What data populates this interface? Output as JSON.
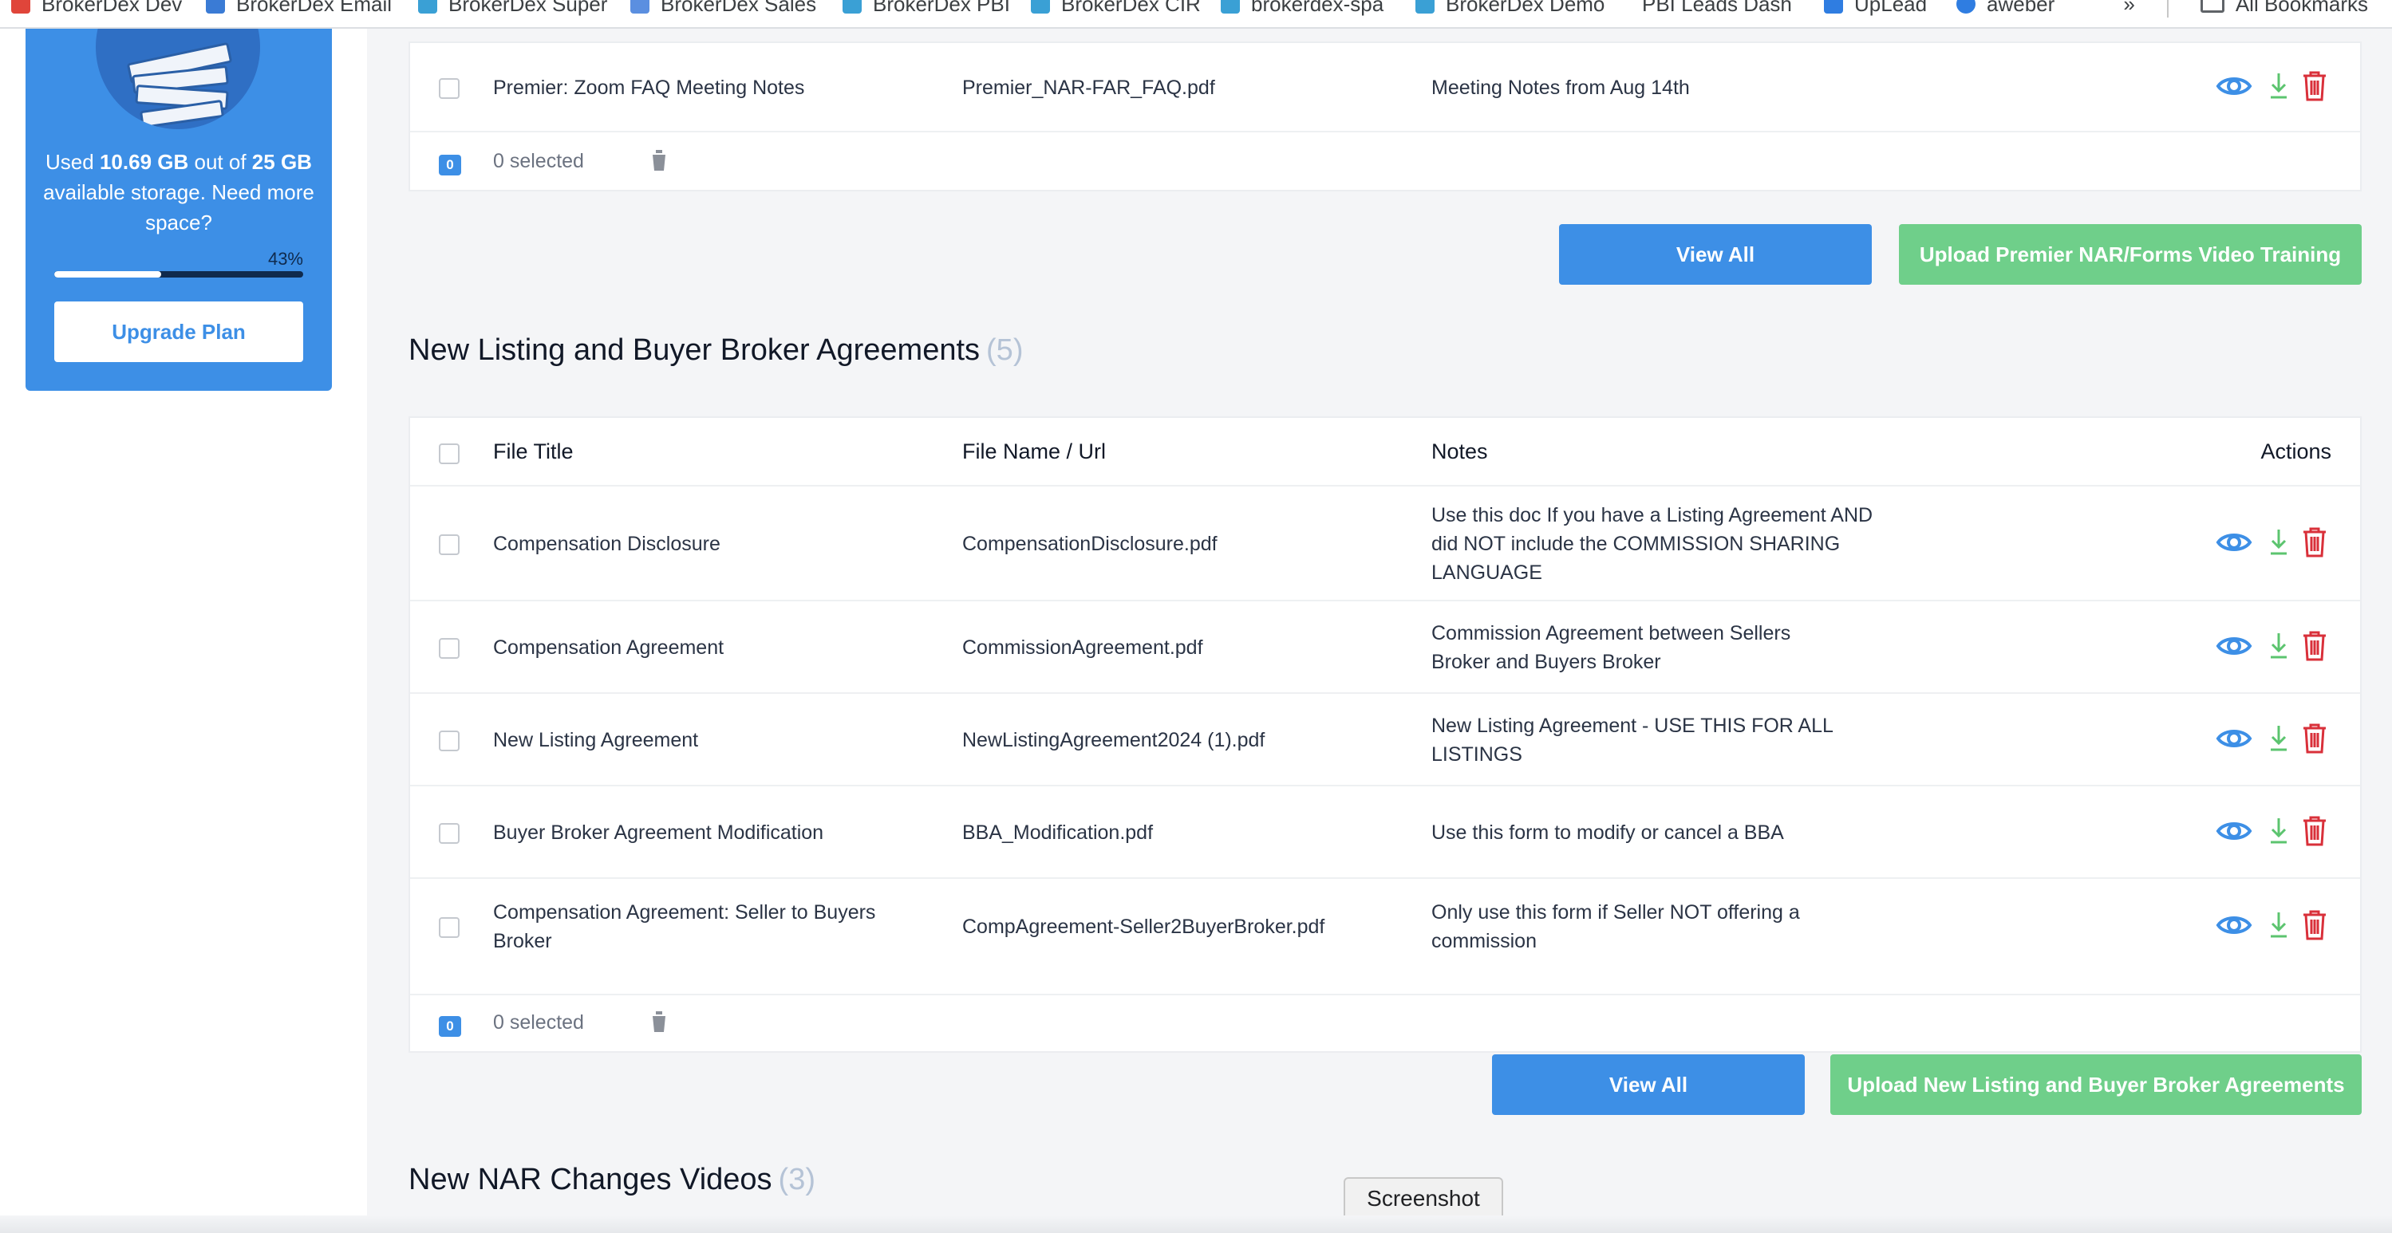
{
  "bookmarks": {
    "items": [
      {
        "label": "BrokerDex Dev",
        "color": "#e0453a"
      },
      {
        "label": "BrokerDex Email",
        "color": "#3a7bd5"
      },
      {
        "label": "BrokerDex Super",
        "color": "#3aa0d5"
      },
      {
        "label": "BrokerDex Sales",
        "color": "#5b8fe0"
      },
      {
        "label": "BrokerDex PBI",
        "color": "#3aa0d5"
      },
      {
        "label": "BrokerDex CIR",
        "color": "#3aa0d5"
      },
      {
        "label": "brokerdex-spa",
        "color": "#3aa0d5"
      },
      {
        "label": "BrokerDex Demo",
        "color": "#3aa0d5"
      },
      {
        "label": "PBI Leads Dash",
        "color": "#ffffff"
      },
      {
        "label": "UpLead",
        "color": "#2f7de1"
      },
      {
        "label": "aweber",
        "color": "#2f7de1"
      }
    ],
    "more": "»",
    "all_bookmarks": "All Bookmarks"
  },
  "storage": {
    "used_prefix": "Used",
    "used_amount": "10.69 GB",
    "out_of": "out of",
    "total": "25 GB",
    "available": "available storage.",
    "need_more": "Need more space?",
    "percent_label": "43%",
    "percent": 0.43,
    "upgrade_label": "Upgrade Plan"
  },
  "premier": {
    "row": {
      "title": "Premier: Zoom FAQ Meeting Notes",
      "file": "Premier_NAR-FAR_FAQ.pdf",
      "notes": "Meeting Notes from Aug 14th"
    },
    "selected_count": "0",
    "selected_text": "0 selected",
    "view_all_label": "View All",
    "upload_label": "Upload Premier NAR/Forms Video Training"
  },
  "agreements": {
    "title": "New Listing and Buyer Broker Agreements",
    "count": "(5)",
    "headers": {
      "title": "File Title",
      "file": "File Name / Url",
      "notes": "Notes",
      "actions": "Actions"
    },
    "rows": [
      {
        "title": "Compensation Disclosure",
        "file": "CompensationDisclosure.pdf",
        "notes": "Use this doc If you have a Listing Agreement AND did NOT include the COMMISSION SHARING LANGUAGE"
      },
      {
        "title": "Compensation Agreement",
        "file": "CommissionAgreement.pdf",
        "notes": "Commission Agreement between Sellers Broker and Buyers Broker"
      },
      {
        "title": "New Listing Agreement",
        "file": "NewListingAgreement2024 (1).pdf",
        "notes": "New Listing Agreement - USE THIS FOR ALL LISTINGS"
      },
      {
        "title": "Buyer Broker Agreement Modification",
        "file": "BBA_Modification.pdf",
        "notes": "Use this form to modify or cancel a BBA"
      },
      {
        "title": "Compensation Agreement: Seller to Buyers Broker",
        "file": "CompAgreement-Seller2BuyerBroker.pdf",
        "notes": "Only use this form if Seller NOT offering a commission"
      }
    ],
    "selected_count": "0",
    "selected_text": "0 selected",
    "view_all_label": "View All",
    "upload_label": "Upload New Listing and Buyer Broker Agreements"
  },
  "videos": {
    "title": "New NAR Changes Videos",
    "count": "(3)"
  },
  "tooltip": "Screenshot",
  "colors": {
    "primary": "#3d8fe6",
    "success": "#6fcf8a",
    "view_icon": "#3d8fe6",
    "download_icon": "#5cc46f",
    "delete_icon": "#d9303a"
  }
}
